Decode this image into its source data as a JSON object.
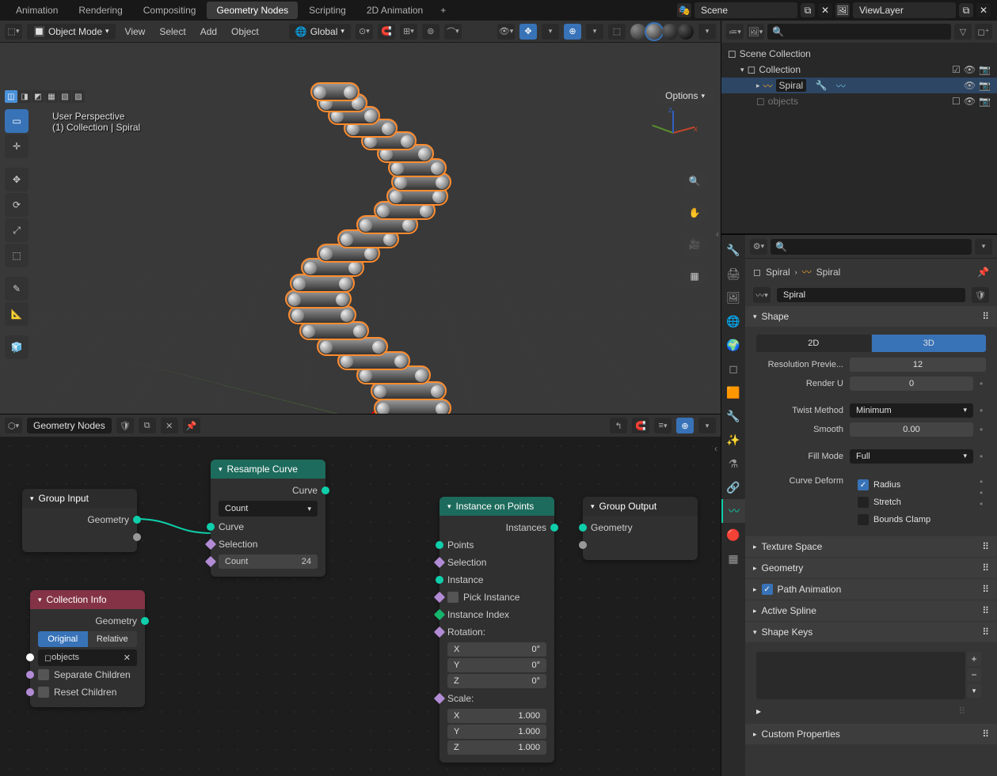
{
  "workspaces": [
    "Animation",
    "Rendering",
    "Compositing",
    "Geometry Nodes",
    "Scripting",
    "2D Animation"
  ],
  "active_workspace": 3,
  "scene_name": "Scene",
  "view_layer": "ViewLayer",
  "viewport": {
    "mode": "Object Mode",
    "menus": [
      "View",
      "Select",
      "Add",
      "Object"
    ],
    "orientation": "Global",
    "options_label": "Options",
    "info1": "User Perspective",
    "info2": "(1) Collection | Spiral"
  },
  "node_editor": {
    "tree_name": "Geometry Nodes",
    "nodes": {
      "group_input": {
        "title": "Group Input",
        "outputs": [
          "Geometry"
        ]
      },
      "resample": {
        "title": "Resample Curve",
        "out": "Curve",
        "mode": "Count",
        "inputs": [
          "Curve",
          "Selection"
        ],
        "count_label": "Count",
        "count_value": "24"
      },
      "collection_info": {
        "title": "Collection Info",
        "out": "Geometry",
        "modes": [
          "Original",
          "Relative"
        ],
        "collection": "objects",
        "checks": [
          "Separate Children",
          "Reset Children"
        ]
      },
      "instance": {
        "title": "Instance on Points",
        "out": "Instances",
        "inputs": [
          "Points",
          "Selection",
          "Instance",
          "Pick Instance",
          "Instance Index",
          "Rotation:",
          "Scale:"
        ],
        "rotation": [
          [
            "X",
            "0°"
          ],
          [
            "Y",
            "0°"
          ],
          [
            "Z",
            "0°"
          ]
        ],
        "scale": [
          [
            "X",
            "1.000"
          ],
          [
            "Y",
            "1.000"
          ],
          [
            "Z",
            "1.000"
          ]
        ]
      },
      "group_output": {
        "title": "Group Output",
        "in": "Geometry"
      }
    }
  },
  "outliner": {
    "root": "Scene Collection",
    "collection": "Collection",
    "items": [
      "Spiral",
      "objects"
    ]
  },
  "properties": {
    "breadcrumb": [
      "Spiral",
      "Spiral"
    ],
    "datablock": "Spiral",
    "shape": {
      "title": "Shape",
      "dims": [
        "2D",
        "3D"
      ],
      "res_preview_label": "Resolution Previe...",
      "res_preview": "12",
      "render_u_label": "Render U",
      "render_u": "0",
      "twist_label": "Twist Method",
      "twist_value": "Minimum",
      "smooth_label": "Smooth",
      "smooth_value": "0.00",
      "fill_label": "Fill Mode",
      "fill_value": "Full",
      "deform_label": "Curve Deform",
      "deform_checks": [
        "Radius",
        "Stretch",
        "Bounds Clamp"
      ]
    },
    "panels": [
      "Texture Space",
      "Geometry",
      "Path Animation",
      "Active Spline",
      "Shape Keys",
      "Custom Properties"
    ]
  }
}
